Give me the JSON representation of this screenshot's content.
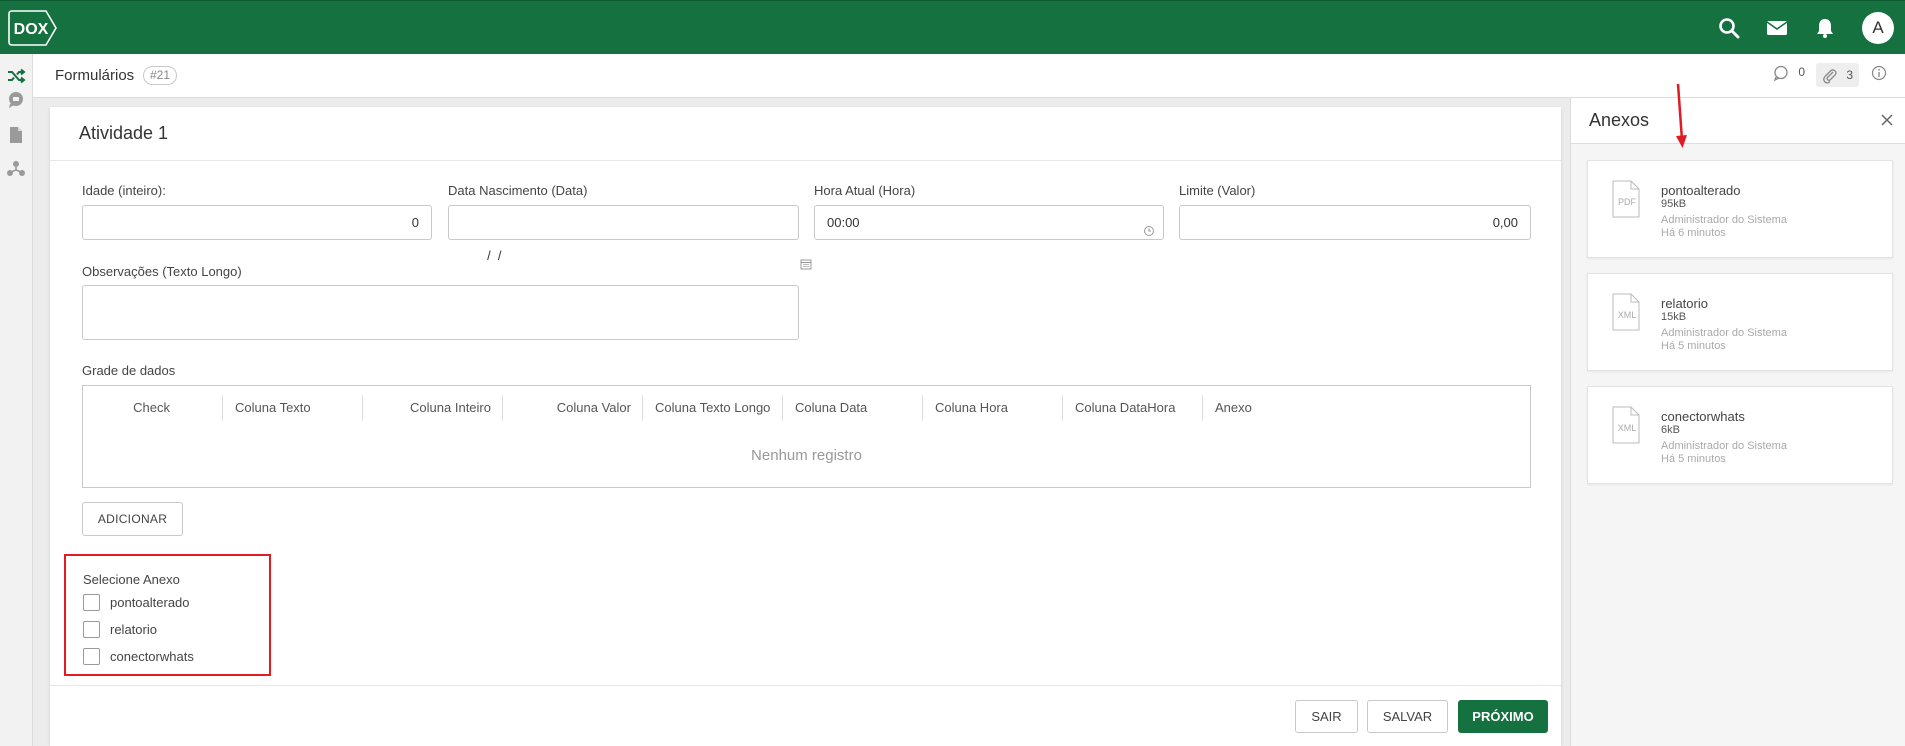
{
  "app": {
    "logo_text": "DOX"
  },
  "header": {
    "avatar_letter": "A"
  },
  "subheader": {
    "title": "Formulários",
    "badge": "#21",
    "comments_count": "0",
    "attachments_count": "3"
  },
  "form": {
    "title": "Atividade 1",
    "fields": {
      "idade": {
        "label": "Idade (inteiro):",
        "value": "0"
      },
      "data_nascimento": {
        "label": "Data Nascimento (Data)",
        "value": " /  /"
      },
      "hora_atual": {
        "label": "Hora Atual (Hora)",
        "value": "00:00"
      },
      "limite": {
        "label": "Limite (Valor)",
        "value": "0,00"
      },
      "observacoes": {
        "label": "Observações (Texto Longo)"
      }
    },
    "grid": {
      "label": "Grade de dados",
      "columns": [
        "Check",
        "Coluna Texto",
        "Coluna Inteiro",
        "Coluna Valor",
        "Coluna Texto Longo",
        "Coluna Data",
        "Coluna Hora",
        "Coluna DataHora",
        "Anexo"
      ],
      "empty_text": "Nenhum registro"
    },
    "add_button": "ADICIONAR",
    "select_attachment": {
      "title": "Selecione Anexo",
      "options": [
        "pontoalterado",
        "relatorio",
        "conectorwhats"
      ]
    },
    "buttons": {
      "exit": "SAIR",
      "save": "SALVAR",
      "next": "PRÓXIMO"
    }
  },
  "attachments_panel": {
    "title": "Anexos",
    "items": [
      {
        "type": "PDF",
        "name": "pontoalterado",
        "size": "95kB",
        "owner": "Administrador do Sistema",
        "time": "Há 6 minutos"
      },
      {
        "type": "XML",
        "name": "relatorio",
        "size": "15kB",
        "owner": "Administrador do Sistema",
        "time": "Há 5 minutos"
      },
      {
        "type": "XML",
        "name": "conectorwhats",
        "size": "6kB",
        "owner": "Administrador do Sistema",
        "time": "Há 5 minutos"
      }
    ]
  },
  "colors": {
    "brand": "#157140",
    "highlight": "#e01b24"
  },
  "icons": [
    "search-icon",
    "mail-icon",
    "bell-icon",
    "shuffle-icon",
    "chat-icon",
    "document-icon",
    "network-icon",
    "comment-icon",
    "paperclip-icon",
    "info-icon",
    "calendar-icon",
    "clock-icon",
    "close-icon",
    "file-icon"
  ]
}
